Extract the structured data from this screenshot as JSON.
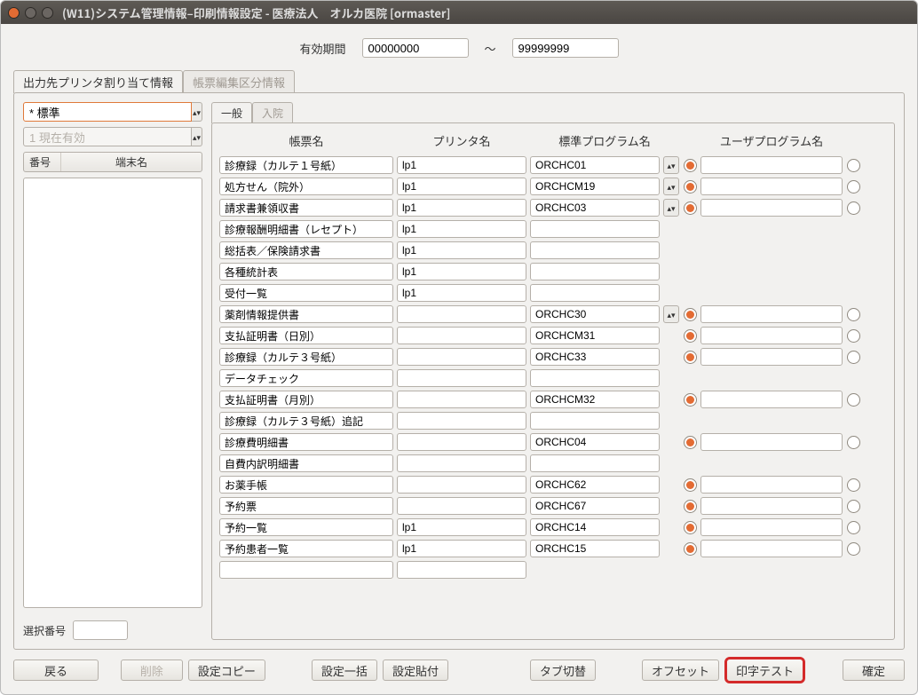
{
  "window_title": "(W11)システム管理情報–印刷情報設定 - 医療法人　オルカ医院  [ormaster]",
  "top": {
    "label": "有効期間",
    "from": "00000000",
    "sep": "～",
    "to": "99999999"
  },
  "outer_tabs": {
    "active": "出力先プリンタ割り当て情報",
    "inactive": "帳票編集区分情報"
  },
  "left": {
    "combo1": "* 標準",
    "combo2": "1 現在有効",
    "list_hdr_num": "番号",
    "list_hdr_term": "端末名",
    "sel_label": "選択番号"
  },
  "inner_tabs": {
    "a": "一般",
    "b": "入院"
  },
  "headers": {
    "c1": "帳票名",
    "c2": "プリンタ名",
    "c3": "標準プログラム名",
    "c4": "ユーザプログラム名"
  },
  "rows": [
    {
      "name": "診療録（カルテ１号紙）",
      "printer": "lp1",
      "std": "ORCHC01",
      "spin": true,
      "std_sel": true
    },
    {
      "name": "処方せん（院外）",
      "printer": "lp1",
      "std": "ORCHCM19",
      "spin": true,
      "std_sel": true
    },
    {
      "name": "請求書兼領収書",
      "printer": "lp1",
      "std": "ORCHC03",
      "spin": true,
      "std_sel": true
    },
    {
      "name": "診療報酬明細書（レセプト）",
      "printer": "lp1",
      "std": "",
      "spin": false,
      "std_sel": null
    },
    {
      "name": "総括表／保険請求書",
      "printer": "lp1",
      "std": "",
      "spin": false,
      "std_sel": null
    },
    {
      "name": "各種統計表",
      "printer": "lp1",
      "std": "",
      "spin": false,
      "std_sel": null
    },
    {
      "name": "受付一覧",
      "printer": "lp1",
      "std": "",
      "spin": false,
      "std_sel": null
    },
    {
      "name": "薬剤情報提供書",
      "printer": "",
      "std": "ORCHC30",
      "spin": true,
      "std_sel": true
    },
    {
      "name": "支払証明書（日別）",
      "printer": "",
      "std": "ORCHCM31",
      "spin": false,
      "std_sel": true
    },
    {
      "name": "診療録（カルテ３号紙）",
      "printer": "",
      "std": "ORCHC33",
      "spin": false,
      "std_sel": true
    },
    {
      "name": "データチェック",
      "printer": "",
      "std": "",
      "spin": false,
      "std_sel": null
    },
    {
      "name": "支払証明書（月別）",
      "printer": "",
      "std": "ORCHCM32",
      "spin": false,
      "std_sel": true
    },
    {
      "name": "診療録（カルテ３号紙）追記",
      "printer": "",
      "std": "",
      "spin": false,
      "std_sel": null
    },
    {
      "name": "診療費明細書",
      "printer": "",
      "std": "ORCHC04",
      "spin": false,
      "std_sel": true
    },
    {
      "name": "自費内訳明細書",
      "printer": "",
      "std": "",
      "spin": false,
      "std_sel": null
    },
    {
      "name": "お薬手帳",
      "printer": "",
      "std": "ORCHC62",
      "spin": false,
      "std_sel": true
    },
    {
      "name": "予約票",
      "printer": "",
      "std": "ORCHC67",
      "spin": false,
      "std_sel": true
    },
    {
      "name": "予約一覧",
      "printer": "lp1",
      "std": "ORCHC14",
      "spin": false,
      "std_sel": true
    },
    {
      "name": "予約患者一覧",
      "printer": "lp1",
      "std": "ORCHC15",
      "spin": false,
      "std_sel": true
    },
    {
      "name": "",
      "printer": "",
      "std": "",
      "spin": false,
      "std_sel": null,
      "emptyTail": true
    }
  ],
  "buttons": {
    "back": "戻る",
    "delete": "削除",
    "copy": "設定コピー",
    "bulk": "設定一括",
    "paste": "設定貼付",
    "tab": "タブ切替",
    "offset": "オフセット",
    "printtest": "印字テスト",
    "ok": "確定"
  }
}
